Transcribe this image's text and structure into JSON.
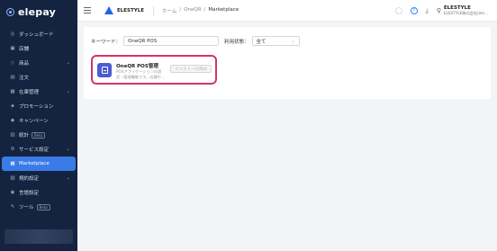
{
  "sidebar": {
    "brand": "elepay",
    "items": [
      {
        "label": "ダッシュボード",
        "icon": "dashboard-icon",
        "glyph": "◎",
        "caret": "",
        "badge": ""
      },
      {
        "label": "店舗",
        "icon": "store-icon",
        "glyph": "▣",
        "caret": "",
        "badge": ""
      },
      {
        "label": "商品",
        "icon": "product-icon",
        "glyph": "◇",
        "caret": "⌄",
        "badge": ""
      },
      {
        "label": "注文",
        "icon": "order-icon",
        "glyph": "▤",
        "caret": "",
        "badge": ""
      },
      {
        "label": "在庫管理",
        "icon": "inventory-icon",
        "glyph": "▦",
        "caret": "⌄",
        "badge": ""
      },
      {
        "label": "プロモーション",
        "icon": "promotion-icon",
        "glyph": "◈",
        "caret": "",
        "badge": ""
      },
      {
        "label": "キャンペーン",
        "icon": "campaign-icon",
        "glyph": "◆",
        "caret": "",
        "badge": ""
      },
      {
        "label": "統計",
        "icon": "stats-icon",
        "glyph": "▥",
        "caret": "",
        "badge": "Beta"
      },
      {
        "label": "サービス設定",
        "icon": "service-settings-icon",
        "glyph": "⚙",
        "caret": "⌄",
        "badge": ""
      },
      {
        "label": "Marketplace",
        "icon": "marketplace-icon",
        "glyph": "▦",
        "caret": "",
        "badge": "",
        "active": true
      },
      {
        "label": "規約設定",
        "icon": "terms-icon",
        "glyph": "▧",
        "caret": "⌄",
        "badge": ""
      },
      {
        "label": "言語設定",
        "icon": "language-icon",
        "glyph": "◉",
        "caret": "",
        "badge": ""
      },
      {
        "label": "ツール",
        "icon": "tool-icon",
        "glyph": "✎",
        "caret": "",
        "badge": "Beta"
      }
    ]
  },
  "header": {
    "shop_name": "ELESTYLE",
    "breadcrumb": {
      "home": "ホーム",
      "sep": "/",
      "app": "OneQR",
      "current": "Marketplace"
    },
    "help_glyph": "?",
    "download_glyph": "⤓",
    "user": {
      "name": "ELESTYLE",
      "sub": "ELESTYLE株式会社(ele...",
      "glyph": "⚲"
    }
  },
  "filters": {
    "keyword_label": "キーワード：",
    "keyword_value": "OneQR POS",
    "status_label": "利用状態：",
    "status_value": "全て",
    "status_chevron": "⌄"
  },
  "app": {
    "title": "OneQR POS管理",
    "description": "POSアプリケーションの設定・管理機能です。店舗や...",
    "install_label": "インストール済み"
  },
  "colors": {
    "sidebar_bg": "#132340",
    "active": "#3b7be8",
    "highlight": "#d6336c",
    "app_icon": "#4b5bd4"
  }
}
